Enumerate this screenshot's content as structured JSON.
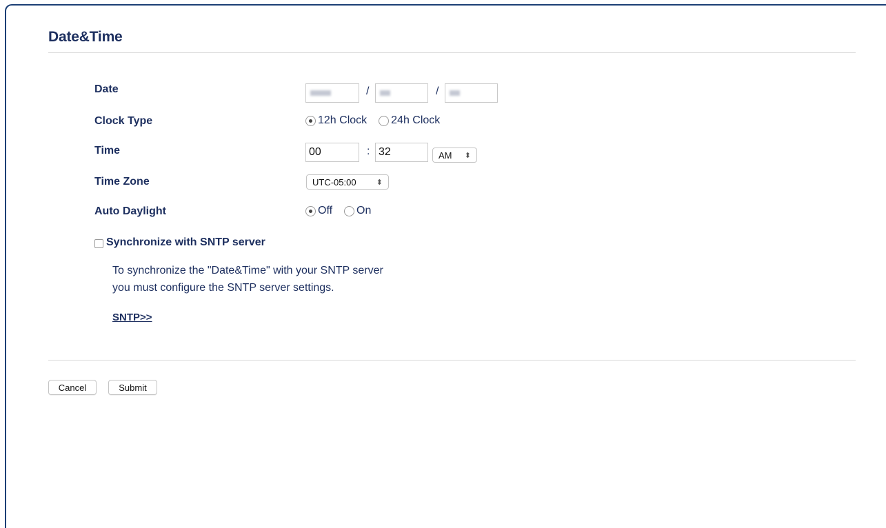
{
  "page": {
    "title": "Date&Time"
  },
  "date": {
    "label": "Date",
    "separator": "/"
  },
  "clock_type": {
    "label": "Clock Type",
    "options": [
      "12h Clock",
      "24h Clock"
    ],
    "selected": "12h Clock"
  },
  "time": {
    "label": "Time",
    "hour": "00",
    "minute": "32",
    "separator": ":",
    "ampm": "AM"
  },
  "time_zone": {
    "label": "Time Zone",
    "value": "UTC-05:00"
  },
  "auto_daylight": {
    "label": "Auto Daylight",
    "options": [
      "Off",
      "On"
    ],
    "selected": "Off"
  },
  "sntp": {
    "checkbox_label": "Synchronize with SNTP server",
    "checked": false,
    "note_line1": "To synchronize the \"Date&Time\" with your SNTP server",
    "note_line2": "you must configure the SNTP server settings.",
    "link": "SNTP>>"
  },
  "buttons": {
    "cancel": "Cancel",
    "submit": "Submit"
  },
  "colors": {
    "text": "#1d2f5f",
    "frame": "#1b3f75",
    "divider": "#d8d8d8"
  }
}
